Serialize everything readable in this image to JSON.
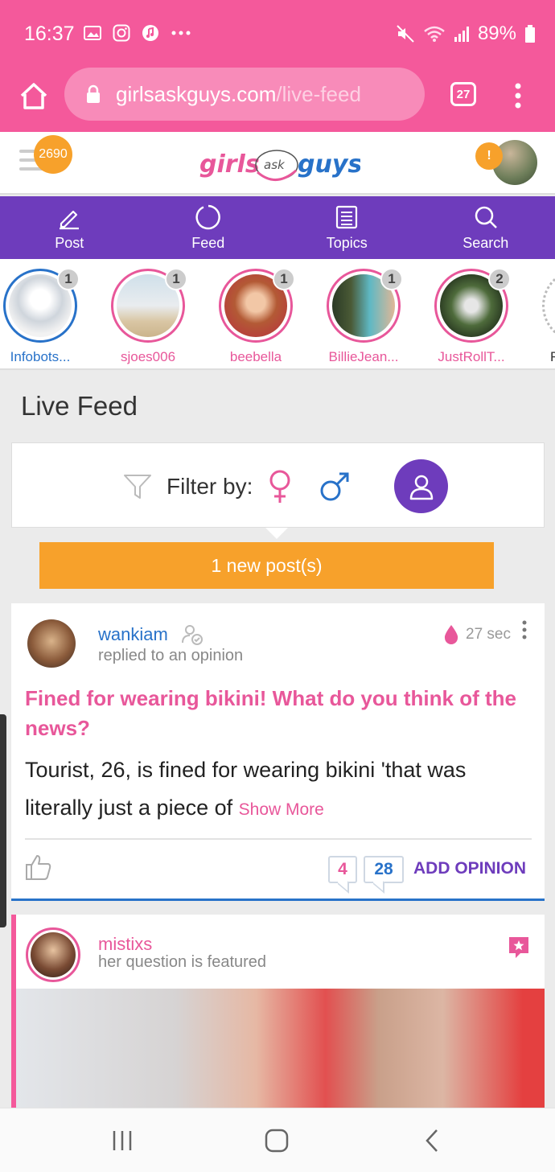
{
  "status_bar": {
    "time": "16:37",
    "battery": "89%",
    "left_icons": [
      "gallery-icon",
      "instagram-icon",
      "music-icon",
      "more-dots-icon"
    ],
    "right_icons": [
      "mute-icon",
      "wifi-icon",
      "signal-icon",
      "battery-icon"
    ]
  },
  "browser": {
    "url_host": "girlsaskguys.com",
    "url_path": "/live-feed",
    "tab_count": "27"
  },
  "site_header": {
    "notification_count": "2690",
    "logo": {
      "left": "girls",
      "middle": "ask",
      "right": "guys"
    },
    "profile_alert": "!"
  },
  "nav": {
    "items": [
      {
        "label": "Post",
        "icon": "pencil-icon"
      },
      {
        "label": "Feed",
        "icon": "circle-feed-icon"
      },
      {
        "label": "Topics",
        "icon": "topics-list-icon"
      },
      {
        "label": "Search",
        "icon": "search-icon"
      }
    ]
  },
  "stories": [
    {
      "name": "Infobots...",
      "count": "1",
      "ring": "blue"
    },
    {
      "name": "sjoes006",
      "count": "1",
      "ring": "pink"
    },
    {
      "name": "beebella",
      "count": "1",
      "ring": "pink"
    },
    {
      "name": "BillieJean...",
      "count": "1",
      "ring": "pink"
    },
    {
      "name": "JustRollT...",
      "count": "2",
      "ring": "pink"
    },
    {
      "name": "F",
      "count": "",
      "ring": "grey"
    }
  ],
  "feed": {
    "title": "Live Feed",
    "filter_label": "Filter by:",
    "new_posts": "1 new post(s)"
  },
  "post1": {
    "user": "wankiam",
    "action": "replied to an opinion",
    "time": "27 sec",
    "title": "Fined for wearing bikini! What do you think of the news?",
    "body": "Tourist, 26, is fined for wearing bikini 'that was literally just a piece of",
    "show_more": "Show More",
    "count_girls": "4",
    "count_guys": "28",
    "add_opinion": "ADD OPINION"
  },
  "post2": {
    "user": "mistixs",
    "action": "her question is featured"
  },
  "colors": {
    "pink": "#f4599b",
    "purple": "#6e3cbc",
    "blue": "#2872c9",
    "orange": "#f7a12b"
  }
}
